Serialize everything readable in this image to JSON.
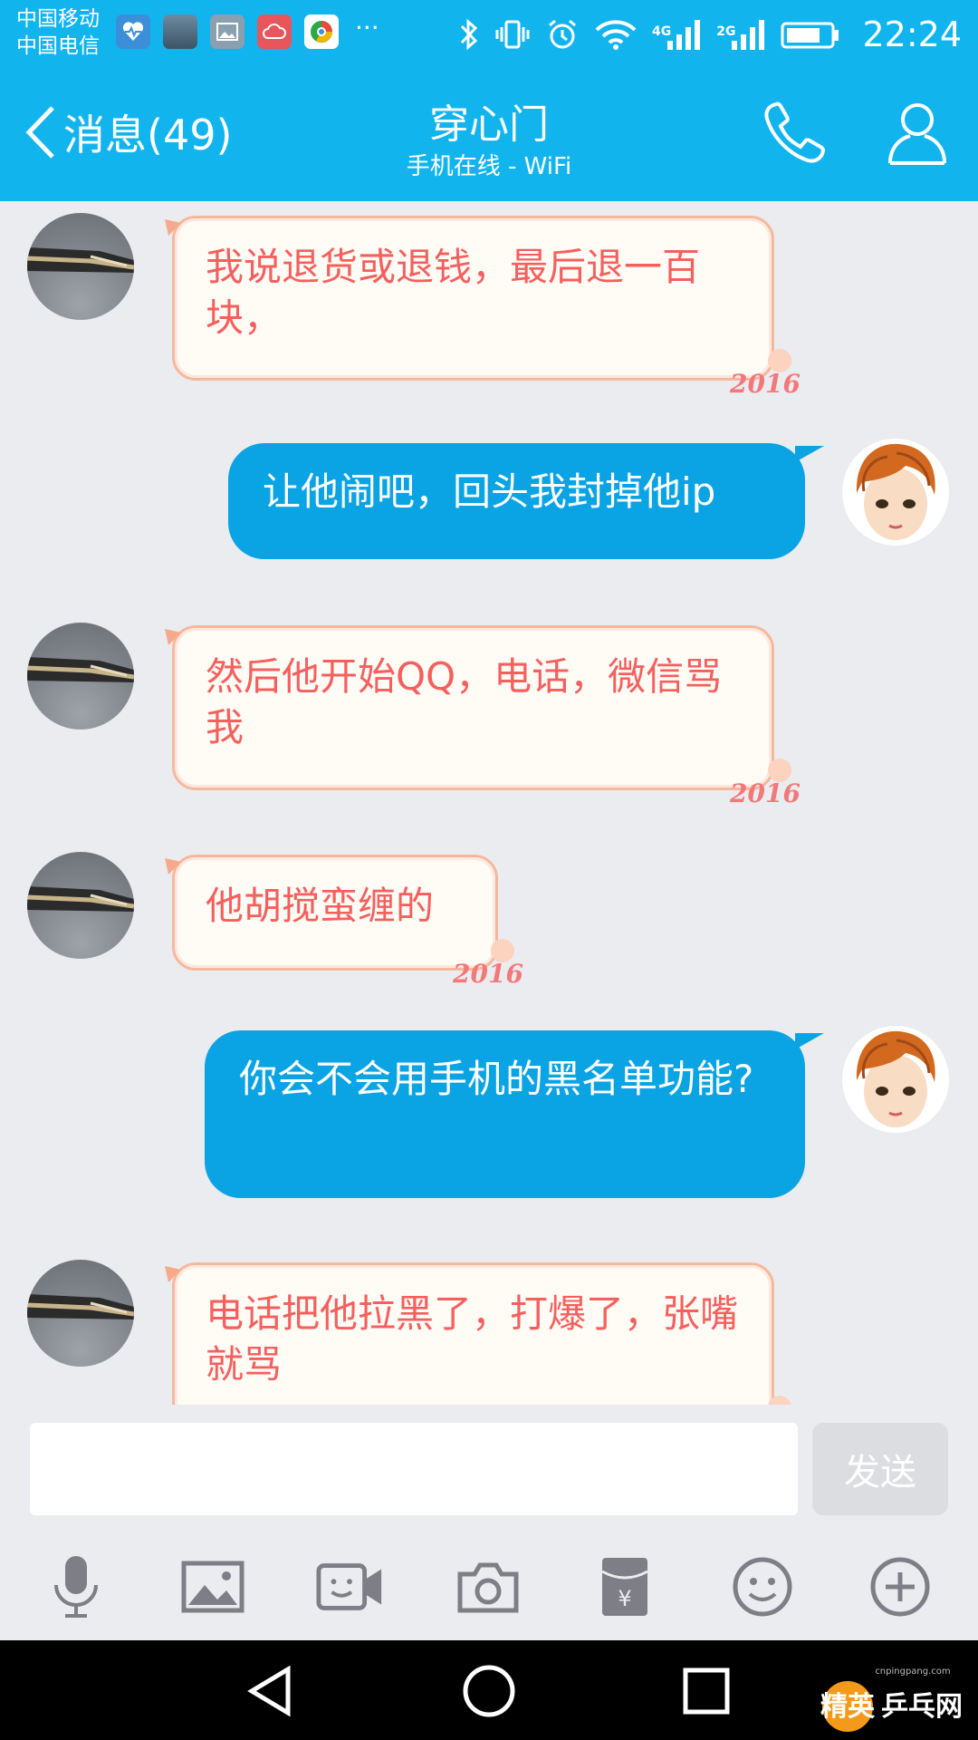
{
  "status_bar": {
    "carrier_1": "中国移动",
    "carrier_2": "中国电信",
    "more": "···",
    "net_4g": "4G",
    "net_2g": "2G",
    "time": "22:24"
  },
  "header": {
    "back_label": "消息(49)",
    "title": "穿心门",
    "subtitle": "手机在线 - WiFi"
  },
  "messages": [
    {
      "side": "in",
      "text": "我说退货或退钱，最后退一百块，",
      "deco": "2016"
    },
    {
      "side": "out",
      "text": "让他闹吧，回头我封掉他ip"
    },
    {
      "side": "in",
      "text": "然后他开始QQ，电话，微信骂我",
      "deco": "2016"
    },
    {
      "side": "in",
      "text": "他胡搅蛮缠的",
      "deco": "2016"
    },
    {
      "side": "out",
      "text": "你会不会用手机的黑名单功能?"
    },
    {
      "side": "in",
      "text": "电话把他拉黑了，打爆了，张嘴就骂"
    }
  ],
  "input": {
    "value": "",
    "send_label": "发送"
  },
  "toolbar": [
    "microphone-icon",
    "image-icon",
    "video-call-icon",
    "camera-icon",
    "red-packet-icon",
    "emoji-icon",
    "plus-icon"
  ],
  "watermark": {
    "site": "cnpingpang.com",
    "logo_text": "精英乒乓网"
  },
  "colors": {
    "brand": "#12b4ee",
    "bubble_out": "#0aa3e4",
    "bubble_in_text": "#f5605e",
    "bubble_in_bg": "#fffbf5"
  }
}
